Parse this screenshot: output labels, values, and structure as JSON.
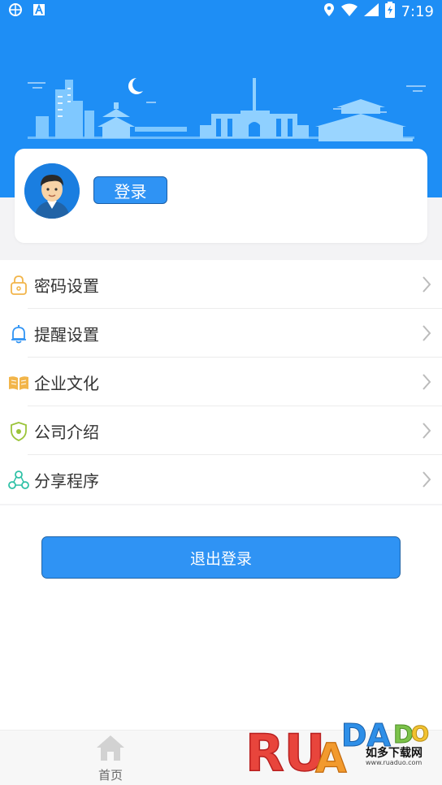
{
  "status_bar": {
    "time": "7:19"
  },
  "profile": {
    "login_label": "登录"
  },
  "menu": {
    "items": [
      {
        "label": "密码设置",
        "icon": "lock-icon",
        "color": "#f2b54a"
      },
      {
        "label": "提醒设置",
        "icon": "bell-icon",
        "color": "#2f93f4"
      },
      {
        "label": "企业文化",
        "icon": "book-icon",
        "color": "#f2b54a"
      },
      {
        "label": "公司介绍",
        "icon": "shield-icon",
        "color": "#9bc43a"
      },
      {
        "label": "分享程序",
        "icon": "share-icon",
        "color": "#2fc1a6"
      }
    ]
  },
  "logout_label": "退出登录",
  "tabbar": {
    "home_label": "首页"
  },
  "watermark": {
    "brand": "RUADADO",
    "sub": "如多下载网",
    "url": "www.ruaduo.com"
  },
  "colors": {
    "primary": "#2f93f4",
    "header_bg": "#1e8ef5"
  }
}
